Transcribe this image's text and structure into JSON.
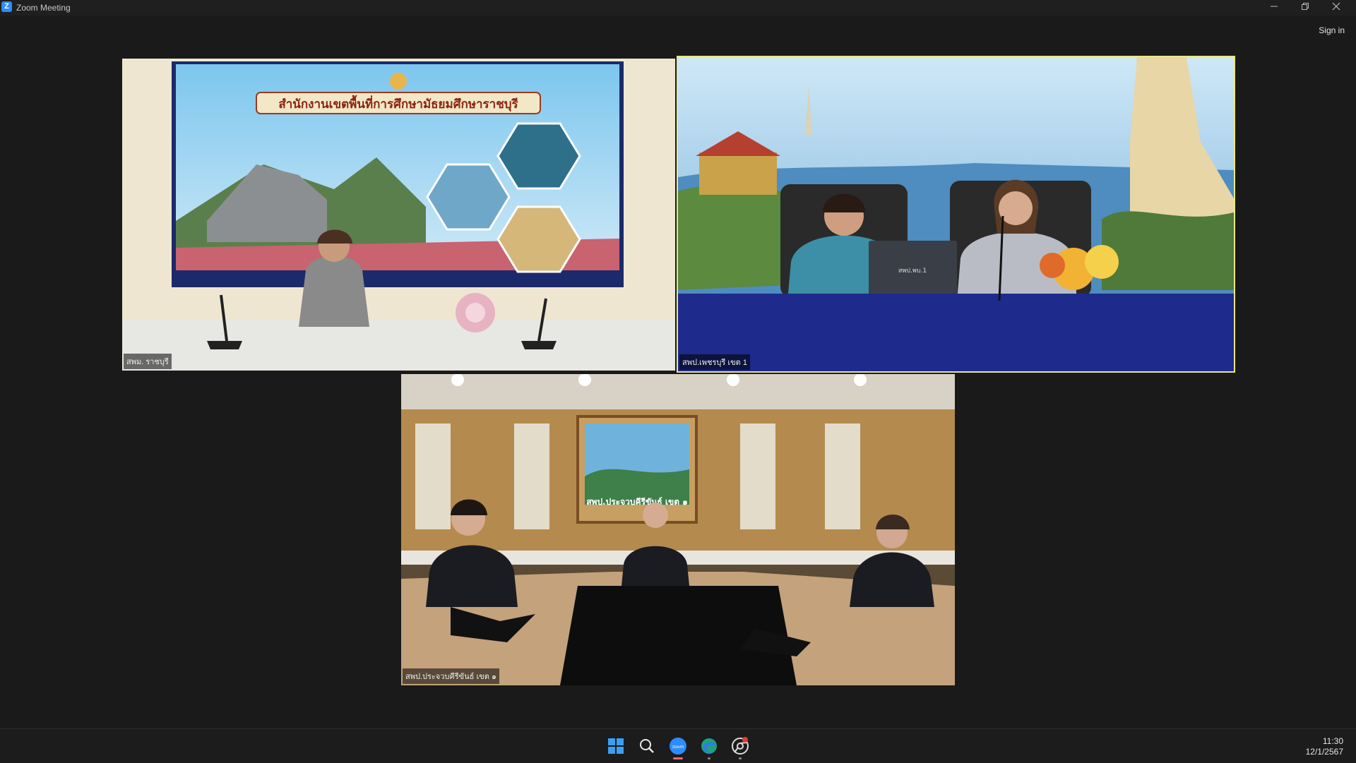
{
  "window": {
    "title": "Zoom Meeting",
    "logo_letter": "Z",
    "sign_in_label": "Sign in"
  },
  "tiles": [
    {
      "name": "สพม. ราชบุรี",
      "banner_text": "สำนักงานเขตพื้นที่การศึกษามัธยมศึกษาราชบุรี",
      "active_speaker": false
    },
    {
      "name": "สพป.เพชรบุรี เขต 1",
      "laptop_text": "สพป.พบ.1",
      "active_speaker": true
    },
    {
      "name": "สพป.ประจวบคีรีขันธ์ เขต ๑",
      "frame_text": "สพป.ประจวบคีรีขันธ์ เขต ๑",
      "active_speaker": false
    }
  ],
  "taskbar": {
    "icons": [
      "windows-start-icon",
      "search-icon",
      "zoom-icon",
      "edge-icon",
      "chrome-icon"
    ],
    "zoom_icon_text": "zoom",
    "time": "11:30",
    "date": "12/1/2567"
  },
  "colors": {
    "active_speaker_border": "#e6e68a",
    "zoom_blue": "#2d8cff"
  }
}
